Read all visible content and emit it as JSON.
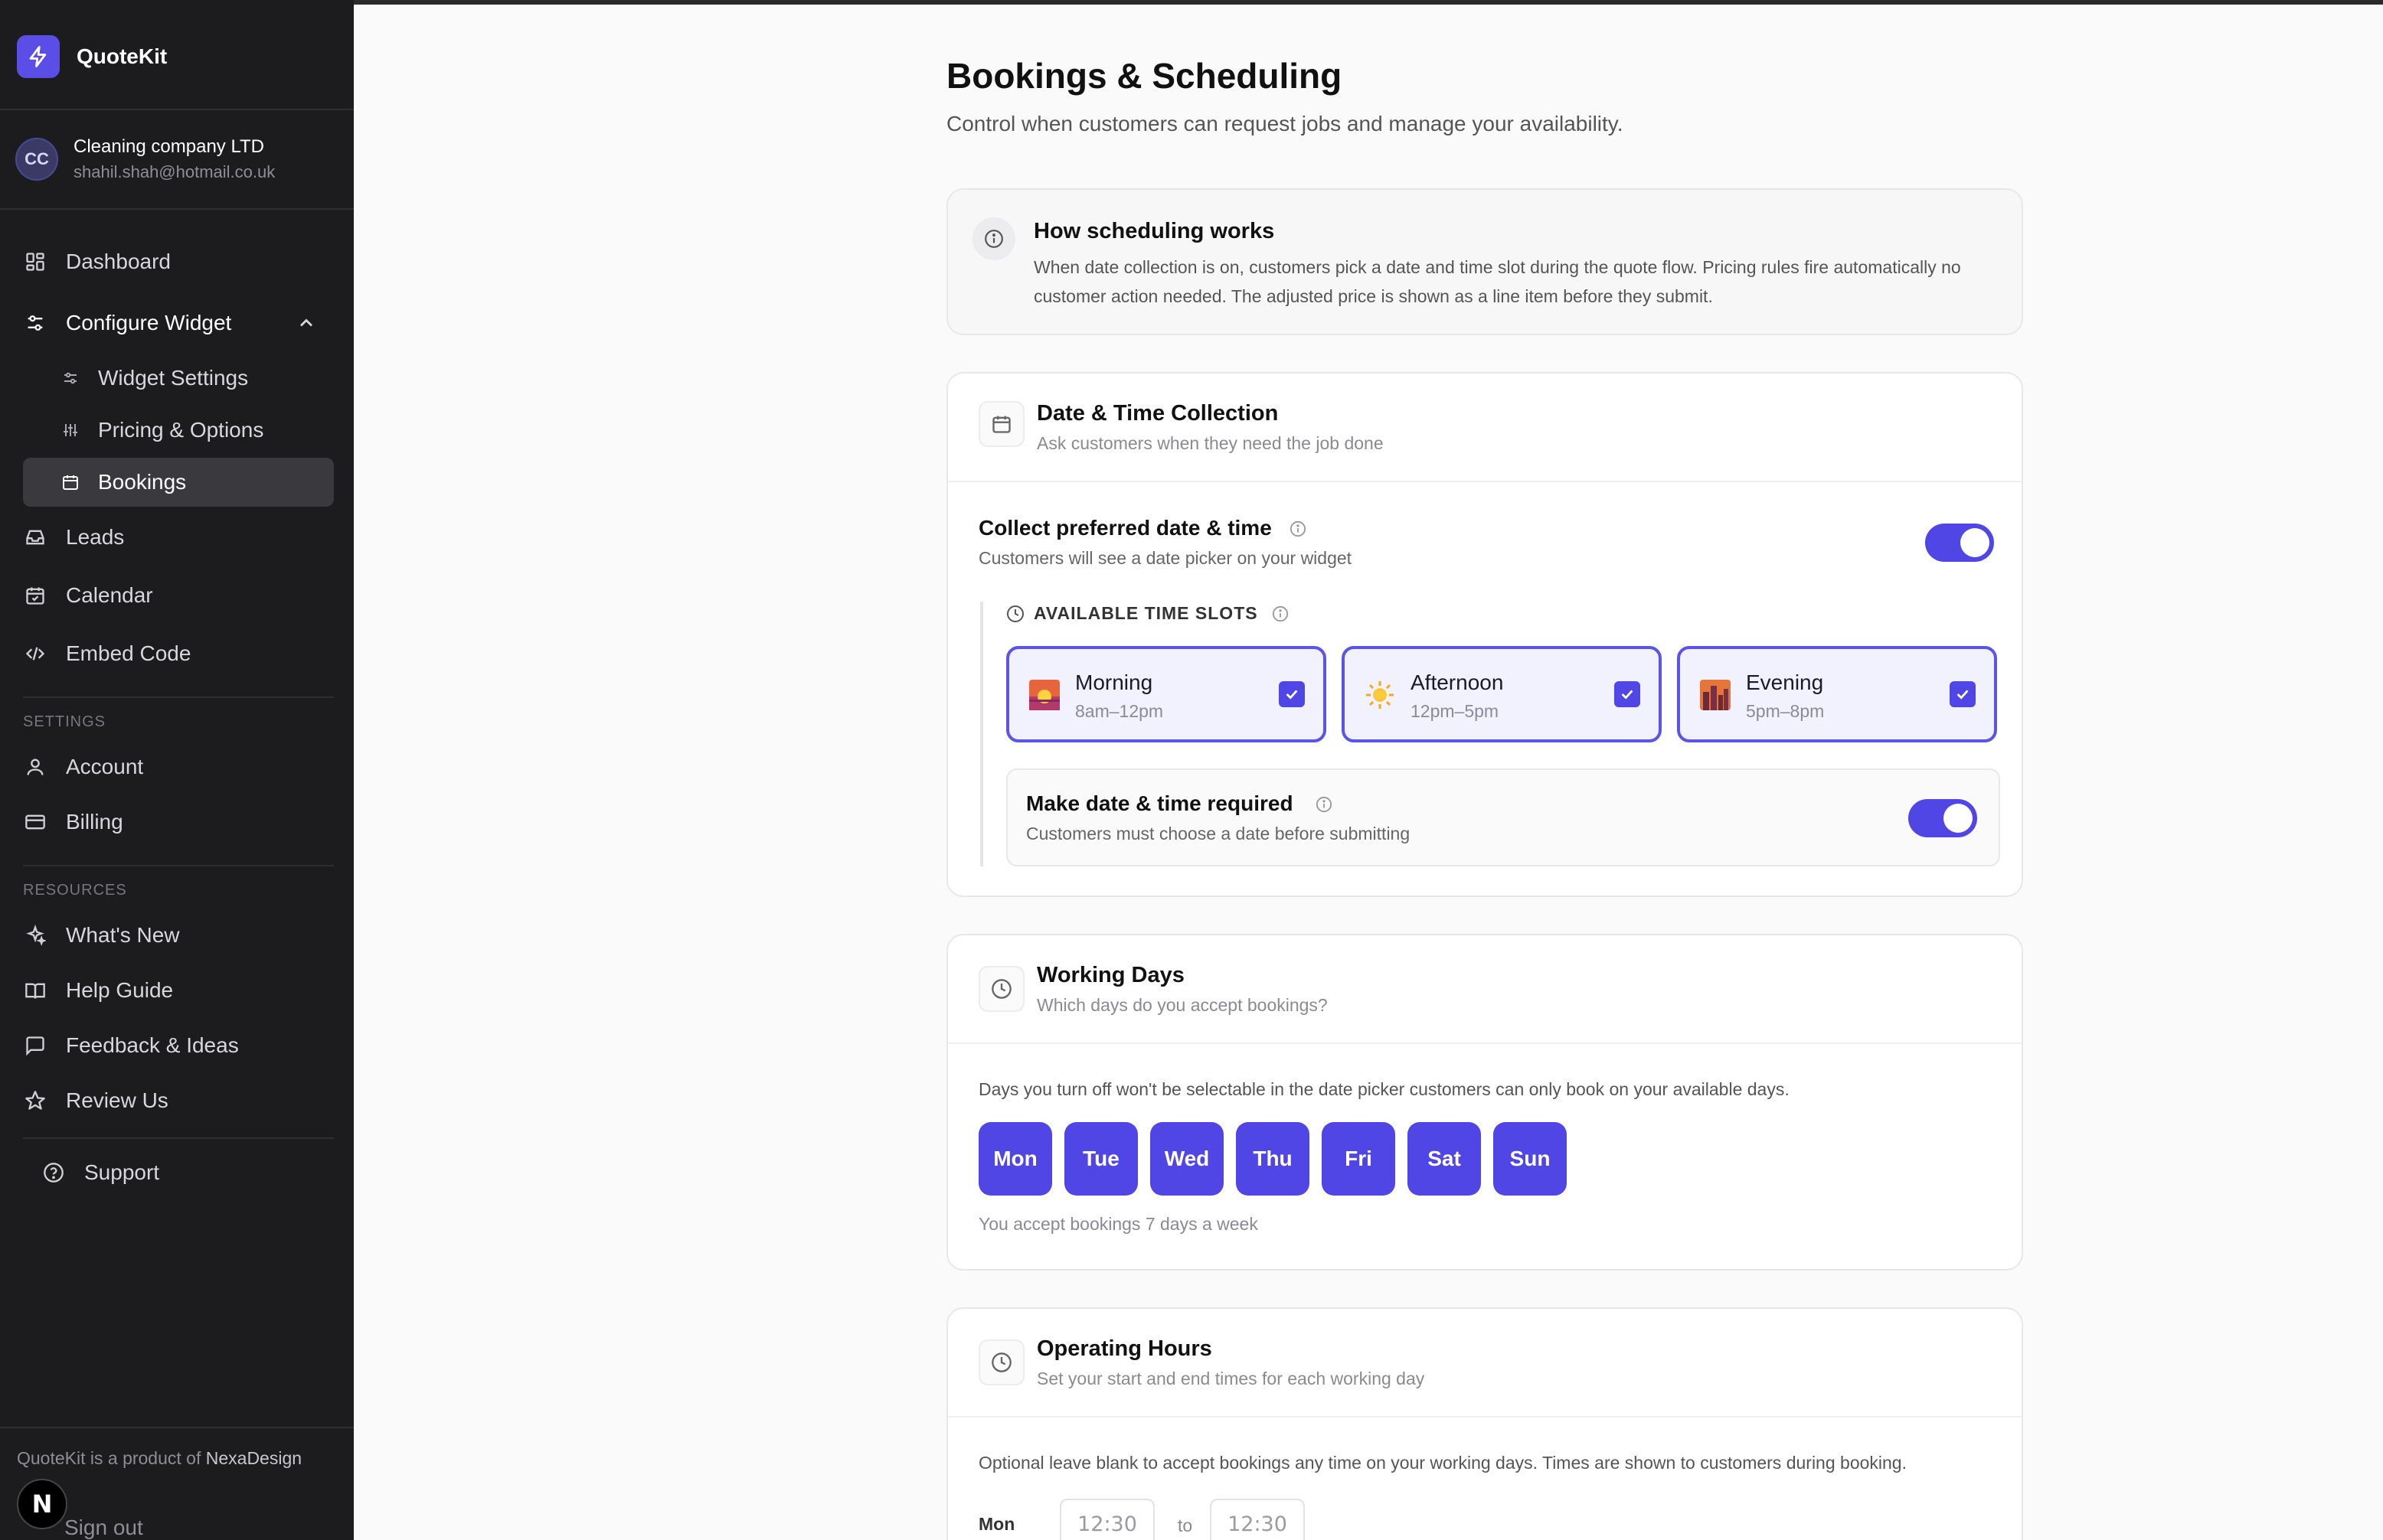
{
  "brand": {
    "name": "QuoteKit"
  },
  "account": {
    "initials": "CC",
    "name": "Cleaning company LTD",
    "email": "shahil.shah@hotmail.co.uk"
  },
  "nav": {
    "dashboard": "Dashboard",
    "configure": "Configure Widget",
    "widget_settings": "Widget Settings",
    "pricing": "Pricing & Options",
    "bookings": "Bookings",
    "leads": "Leads",
    "calendar": "Calendar",
    "embed": "Embed Code",
    "settings_label": "SETTINGS",
    "account": "Account",
    "billing": "Billing",
    "resources_label": "RESOURCES",
    "whats_new": "What's New",
    "help": "Help Guide",
    "feedback": "Feedback & Ideas",
    "review": "Review Us",
    "support": "Support"
  },
  "footer": {
    "prefix": "QuoteKit is a product of ",
    "company": "NexaDesign",
    "badge": "N",
    "signout": "Sign out"
  },
  "page": {
    "title": "Bookings & Scheduling",
    "subtitle": "Control when customers can request jobs and manage your availability."
  },
  "info": {
    "title": "How scheduling works",
    "body": "When date collection is on, customers pick a date and time slot during the quote flow. Pricing rules fire automatically no customer action needed. The adjusted price is shown as a line item before they submit."
  },
  "datetime": {
    "title": "Date & Time Collection",
    "subtitle": "Ask customers when they need the job done",
    "collect_title": "Collect preferred date & time",
    "collect_sub": "Customers will see a date picker on your widget",
    "collect_enabled": true,
    "slots_label": "AVAILABLE TIME SLOTS",
    "slots": [
      {
        "name": "Morning",
        "time": "8am–12pm",
        "checked": true,
        "icon": "sunrise-icon"
      },
      {
        "name": "Afternoon",
        "time": "12pm–5pm",
        "checked": true,
        "icon": "sun-icon"
      },
      {
        "name": "Evening",
        "time": "5pm–8pm",
        "checked": true,
        "icon": "sunset-city-icon"
      }
    ],
    "required_title": "Make date & time required",
    "required_sub": "Customers must choose a date before submitting",
    "required_enabled": true
  },
  "working_days": {
    "title": "Working Days",
    "subtitle": "Which days do you accept bookings?",
    "description": "Days you turn off won't be selectable in the date picker customers can only book on your available days.",
    "days": [
      "Mon",
      "Tue",
      "Wed",
      "Thu",
      "Fri",
      "Sat",
      "Sun"
    ],
    "footer": "You accept bookings 7 days a week"
  },
  "operating_hours": {
    "title": "Operating Hours",
    "subtitle": "Set your start and end times for each working day",
    "description": "Optional leave blank to accept bookings any time on your working days. Times are shown to customers during booking.",
    "first_day": "Mon",
    "start_placeholder": "12:30",
    "to_label": "to",
    "end_placeholder": "12:30"
  },
  "colors": {
    "accent": "#4f46e5",
    "sidebar_bg": "#1c1c1e",
    "page_bg": "#fafafa"
  }
}
